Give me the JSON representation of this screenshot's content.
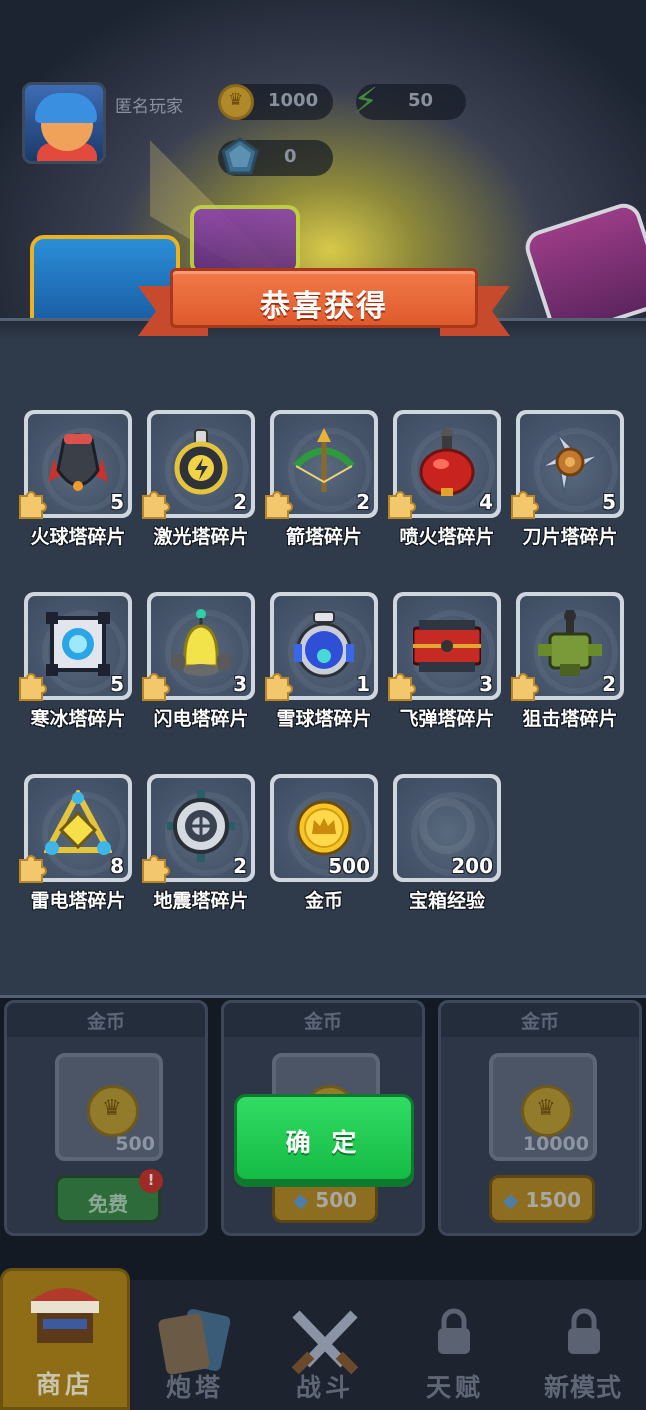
{
  "player": {
    "name": "匿名玩家"
  },
  "currency": {
    "coins": "1000",
    "energy": "50",
    "gems": "0"
  },
  "modal": {
    "title": "恭喜获得",
    "items": [
      {
        "name": "火球塔碎片",
        "count": "5",
        "icon": "fireball-tower-icon",
        "fragment": true
      },
      {
        "name": "激光塔碎片",
        "count": "2",
        "icon": "laser-tower-icon",
        "fragment": true
      },
      {
        "name": "箭塔碎片",
        "count": "2",
        "icon": "crossbow-tower-icon",
        "fragment": true
      },
      {
        "name": "喷火塔碎片",
        "count": "4",
        "icon": "flamethrower-tower-icon",
        "fragment": true
      },
      {
        "name": "刀片塔碎片",
        "count": "5",
        "icon": "blade-tower-icon",
        "fragment": true
      },
      {
        "name": "寒冰塔碎片",
        "count": "5",
        "icon": "ice-tower-icon",
        "fragment": true
      },
      {
        "name": "闪电塔碎片",
        "count": "3",
        "icon": "lightning-tower-icon",
        "fragment": true
      },
      {
        "name": "雪球塔碎片",
        "count": "1",
        "icon": "snowball-tower-icon",
        "fragment": true
      },
      {
        "name": "飞弹塔碎片",
        "count": "3",
        "icon": "missile-tower-icon",
        "fragment": true
      },
      {
        "name": "狙击塔碎片",
        "count": "2",
        "icon": "sniper-tower-icon",
        "fragment": true
      },
      {
        "name": "雷电塔碎片",
        "count": "8",
        "icon": "thunder-tower-icon",
        "fragment": true
      },
      {
        "name": "地震塔碎片",
        "count": "2",
        "icon": "earthquake-tower-icon",
        "fragment": true
      },
      {
        "name": "金币",
        "count": "500",
        "icon": "gold-coin-icon",
        "fragment": false
      },
      {
        "name": "宝箱经验",
        "count": "200",
        "icon": "chest-exp-icon",
        "fragment": false
      }
    ],
    "confirm_label": "确 定"
  },
  "shop": {
    "cards": [
      {
        "header": "金币",
        "amount": "500",
        "price": "免费",
        "price_type": "free",
        "badge": "!"
      },
      {
        "header": "金币",
        "amount": "",
        "price": "500",
        "price_type": "gem"
      },
      {
        "header": "金币",
        "amount": "10000",
        "price": "1500",
        "price_type": "gem"
      }
    ]
  },
  "nav": {
    "items": [
      {
        "label": "商店",
        "active": true
      },
      {
        "label": "炮塔"
      },
      {
        "label": "战斗"
      },
      {
        "label": "天赋",
        "locked": true
      },
      {
        "label": "新模式",
        "locked": true
      }
    ]
  },
  "colors": {
    "confirm_green": "#1fcc52",
    "banner_orange": "#e8663a",
    "panel": "#2f3a4b",
    "nav_active": "#8e6d16"
  }
}
